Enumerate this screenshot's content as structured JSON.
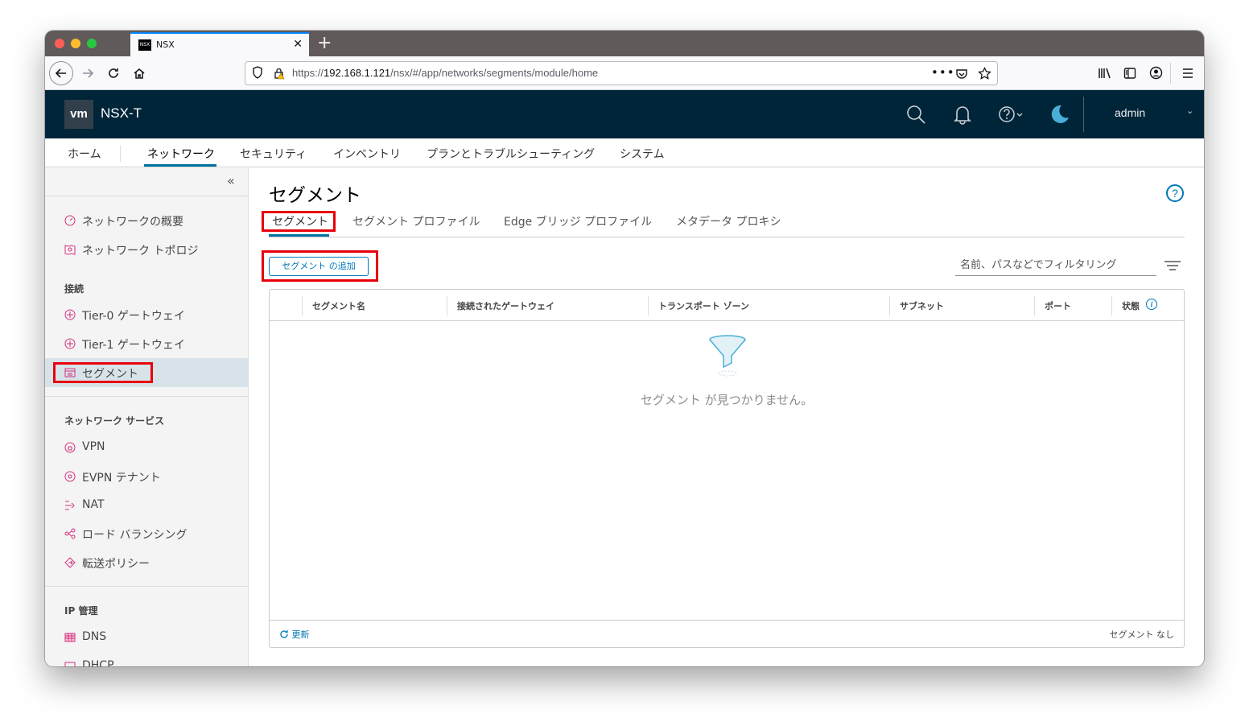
{
  "browser": {
    "tab_title": "NSX",
    "favicon_text": "NSX",
    "tab_close": "✕",
    "new_tab": "+",
    "url_prefix": "https://",
    "url_host": "192.168.1.121",
    "url_path": "/nsx/#/app/networks/segments/module/home"
  },
  "header": {
    "logo": "vm",
    "title": "NSX-T",
    "user": "admin",
    "bg_color": "#002538"
  },
  "main_nav": {
    "items": [
      "ホーム",
      "ネットワーク",
      "セキュリティ",
      "インベントリ",
      "プランとトラブルシューティング",
      "システム"
    ],
    "active": "ネットワーク"
  },
  "sidebar": {
    "collapse": "«",
    "items_top": [
      "ネットワークの概要",
      "ネットワーク トポロジ"
    ],
    "section_connection": "接続",
    "items_connection": [
      "Tier-0 ゲートウェイ",
      "Tier-1 ゲートウェイ",
      "セグメント"
    ],
    "section_services": "ネットワーク サービス",
    "items_services": [
      "VPN",
      "EVPN テナント",
      "NAT",
      "ロード バランシング",
      "転送ポリシー"
    ],
    "section_ip": "IP 管理",
    "items_ip": [
      "DNS",
      "DHCP"
    ],
    "active_item": "セグメント"
  },
  "content": {
    "title": "セグメント",
    "help": "?",
    "tabs": [
      "セグメント",
      "セグメント プロファイル",
      "Edge ブリッジ プロファイル",
      "メタデータ プロキシ"
    ],
    "add_button": "セグメント の追加",
    "filter_placeholder": "名前、パスなどでフィルタリング",
    "columns": [
      "セグメント名",
      "接続されたゲートウェイ",
      "トランスポート ゾーン",
      "サブネット",
      "ポート",
      "状態"
    ],
    "info": "i",
    "empty_message": "セグメント が見つかりません。",
    "refresh": "更新",
    "count": "セグメント なし"
  },
  "colors": {
    "accent": "#0072a3",
    "highlight": "#e8000b"
  }
}
